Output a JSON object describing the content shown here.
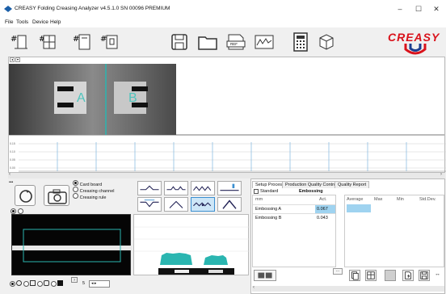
{
  "title_bar": {
    "title": "CREASY Folding Creasing Analyzer v4.5.1.0 SN 00096 PREMIUM",
    "minimize": "–",
    "maximize": "☐",
    "close": "✕"
  },
  "menu": [
    "File",
    "Tools",
    "Device",
    "Help"
  ],
  "toolbar_icons": [
    "hash-icon",
    "hash-grid-icon",
    "hash-notebook-icon",
    "hash-frame-icon",
    "save-icon",
    "folder-icon",
    "ref-icon",
    "chart-icon",
    "calculator-icon",
    "cube-icon"
  ],
  "toolbar": {
    "ref_label": "REF"
  },
  "brand": {
    "logo_text": "CREASY",
    "color": "#d9121b"
  },
  "image_panel": {
    "marker_a": "A",
    "marker_b": "B"
  },
  "profile_panel": {
    "y_ticks": [
      "0.15",
      "0.10",
      "0.05",
      "0.00"
    ]
  },
  "bottom_left": {
    "radios": [
      {
        "label": "Card board",
        "checked": true
      },
      {
        "label": "Creasing channel",
        "checked": false
      },
      {
        "label": "Creasing rule",
        "checked": false
      }
    ],
    "page_value": "5"
  },
  "tabs": [
    {
      "label": "Setup Process",
      "active": true
    },
    {
      "label": "Production Quality Control",
      "active": false
    },
    {
      "label": "Quality Report",
      "active": false
    }
  ],
  "setup": {
    "standard_label": "Standard",
    "embossing_header": "Embossing",
    "col_mm": "mm",
    "col_act": "Act.",
    "rows": [
      {
        "name": "Embossing A",
        "act": "0.067"
      },
      {
        "name": "Embossing B",
        "act": "0.043"
      }
    ],
    "stats_headers": [
      "Average",
      "Max",
      "Min",
      "Std.Dev."
    ],
    "more_button": "..."
  },
  "colors": {
    "accent_teal": "#2ab5b0",
    "selection_blue": "#9fd3f0"
  }
}
